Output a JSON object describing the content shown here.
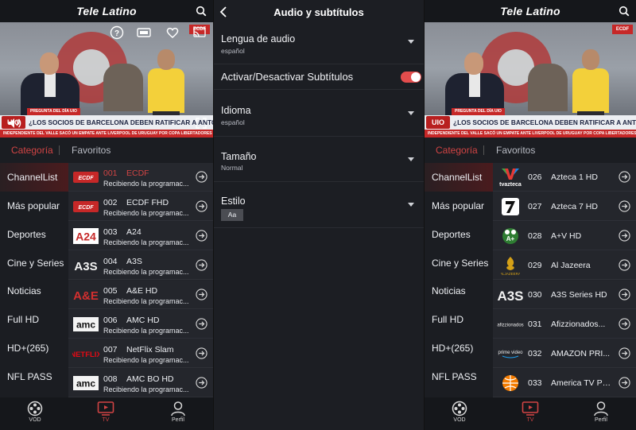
{
  "app": {
    "title": "Tele Latino",
    "tabs": {
      "category": "Categoría",
      "favorites": "Favoritos"
    },
    "categories": [
      "ChannelList",
      "Más popular",
      "Deportes",
      "Cine y Series",
      "Noticias",
      "Full HD",
      "HD+(265)",
      "NFL PASS"
    ],
    "bottom_nav": {
      "vod": "VOD",
      "tv": "TV",
      "profile": "Perfil"
    },
    "video": {
      "channel_logo": "ECDF",
      "pregunta_tag": "PREGUNTA DEL DÍA UIO",
      "badge": "UIO",
      "question": "¿LOS SOCIOS DE BARCELONA DEBEN RATIFICAR A ANTONIO ÁLVAREZ COMO PRESIDENTE?",
      "ticker": "INDEPENDIENTE DEL VALLE SACÓ UN EMPATE ANTE LIVERPOOL DE URUGUAY POR COPA LIBERTADORES"
    },
    "accent_color": "#d14444"
  },
  "left_channels": [
    {
      "number": "001",
      "name": "ECDF",
      "status": "Recibiendo la programac...",
      "logo": "ecdf-logo"
    },
    {
      "number": "002",
      "name": "ECDF FHD",
      "status": "Recibiendo la programac...",
      "logo": "ecdf-logo"
    },
    {
      "number": "003",
      "name": "A24",
      "status": "Recibiendo la programac...",
      "logo": "a24-logo"
    },
    {
      "number": "004",
      "name": "A3S",
      "status": "Recibiendo la programac...",
      "logo": "a3s-logo"
    },
    {
      "number": "005",
      "name": "A&E HD",
      "status": "Recibiendo la programac...",
      "logo": "ae-logo"
    },
    {
      "number": "006",
      "name": "AMC HD",
      "status": "Recibiendo la programac...",
      "logo": "amc-logo"
    },
    {
      "number": "007",
      "name": "NetFlix Slam",
      "status": "Recibiendo la programac...",
      "logo": "netflix-logo"
    },
    {
      "number": "008",
      "name": "AMC BO HD",
      "status": "Recibiendo la programac...",
      "logo": "amc-logo"
    }
  ],
  "right_channels": [
    {
      "number": "026",
      "name": "Azteca 1 HD",
      "logo": "tv-azteca-logo"
    },
    {
      "number": "027",
      "name": "Azteca 7 HD",
      "logo": "azteca7-logo"
    },
    {
      "number": "028",
      "name": "A+V HD",
      "logo": "aplusv-logo"
    },
    {
      "number": "029",
      "name": "Al Jazeera",
      "logo": "aljazeera-logo"
    },
    {
      "number": "030",
      "name": "A3S Series HD",
      "logo": "a3s-logo"
    },
    {
      "number": "031",
      "name": "Afizzionados...",
      "logo": "afizzionados-logo"
    },
    {
      "number": "032",
      "name": "AMAZON PRI...",
      "logo": "prime-video-logo"
    },
    {
      "number": "033",
      "name": "America TV Pe...",
      "logo": "america-tv-logo"
    }
  ],
  "settings": {
    "title": "Audio y subtítulos",
    "audio_language": {
      "label": "Lengua de audio",
      "value": "español"
    },
    "subtitles_toggle": {
      "label": "Activar/Desactivar Subtítulos",
      "on": true
    },
    "language": {
      "label": "Idioma",
      "value": "español"
    },
    "size": {
      "label": "Tamaño",
      "value": "Normal"
    },
    "style": {
      "label": "Estilo",
      "value": "Aa"
    }
  }
}
